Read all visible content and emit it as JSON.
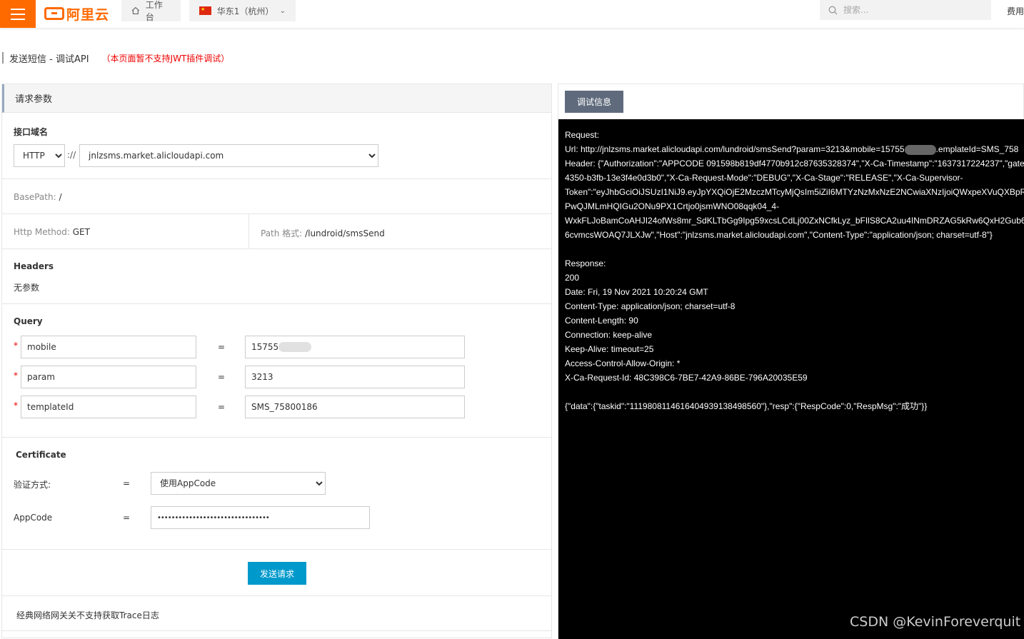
{
  "topbar": {
    "logo_text": "阿里云",
    "workbench_label": "工作台",
    "region_label": "华东1（杭州）",
    "search_placeholder": "搜索...",
    "fee_label": "费用",
    "accent": "#ff6a00"
  },
  "page": {
    "title": "发送短信 - 调试API",
    "note": "（本页面暂不支持JWT插件调试）"
  },
  "form": {
    "header": "请求参数",
    "domain_label": "接口域名",
    "protocol_value": "HTTP",
    "protocol_separator": "://",
    "domain_value": "jnlzsms.market.alicloudapi.com",
    "basepath_label": "BasePath:",
    "basepath_value": "/",
    "http_method_label": "Http Method:",
    "http_method_value": "GET",
    "path_label": "Path 格式:",
    "path_value": "/lundroid/smsSend",
    "headers_label": "Headers",
    "headers_value": "无参数",
    "query_label": "Query",
    "query": [
      {
        "name": "mobile",
        "value": "15755"
      },
      {
        "name": "param",
        "value": "3213"
      },
      {
        "name": "templateId",
        "value": "SMS_75800186"
      }
    ],
    "required_mark": "*",
    "eq": "=",
    "certificate_label": "Certificate",
    "auth_label": "验证方式:",
    "auth_value": "使用AppCode",
    "appcode_label": "AppCode",
    "appcode_value": "••••••••••••••••••••••••••••••••",
    "send_label": "发送请求",
    "trace_note": "经典网络网关关不支持获取Trace日志"
  },
  "debug": {
    "tab_label": "调试信息",
    "lines": [
      "Request:",
      "Url: http://jnlzsms.market.alicloudapi.com/lundroid/smsSend?param=3213&mobile=15755",
      "Header: {\"Authorization\":\"APPCODE 091598b819df4770b912c87635328374\",\"X-Ca-Timestamp\":\"1637317224237\",\"gatew",
      "4350-b3fb-13e3f4e0d3b0\",\"X-Ca-Request-Mode\":\"DEBUG\",\"X-Ca-Stage\":\"RELEASE\",\"X-Ca-Supervisor-",
      "Token\":\"eyJhbGciOiJSUzI1NiJ9.eyJpYXQiOjE2MzczMTcyMjQsIm5iZiI6MTYzNzMxNzE2NCwiaXNzIjoiQWxpeXVuQXBpR2F0Z",
      "PwQJMLmHQIGu2ONu9PX1Crtjo0jsmWNO08qqk04_4-",
      "WxkFLJoBamCoAHJI24ofWs8mr_SdKLTbGg9Ipg59xcsLCdLj00ZxNCfkLyz_bFIlS8CA2uu4INmDRZAG5kRw6QxH2Gub6uvqsO",
      "6cvmcsWOAQ7JLXJw\",\"Host\":\"jnlzsms.market.alicloudapi.com\",\"Content-Type\":\"application/json; charset=utf-8\"}",
      "",
      "Response:",
      "200",
      "Date: Fri, 19 Nov 2021 10:20:24 GMT",
      "Content-Type: application/json; charset=utf-8",
      "Content-Length: 90",
      "Connection: keep-alive",
      "Keep-Alive: timeout=25",
      "Access-Control-Allow-Origin: *",
      "X-Ca-Request-Id: 48C398C6-7BE7-42A9-86BE-796A20035E59",
      "",
      "{\"data\":{\"taskid\":\"1119808114616404939138498560\"},\"resp\":{\"RespCode\":0,\"RespMsg\":\"成功\"}}"
    ],
    "url_suffix": ".emplateId=SMS_758"
  },
  "watermark": "CSDN @KevinForeverquit"
}
